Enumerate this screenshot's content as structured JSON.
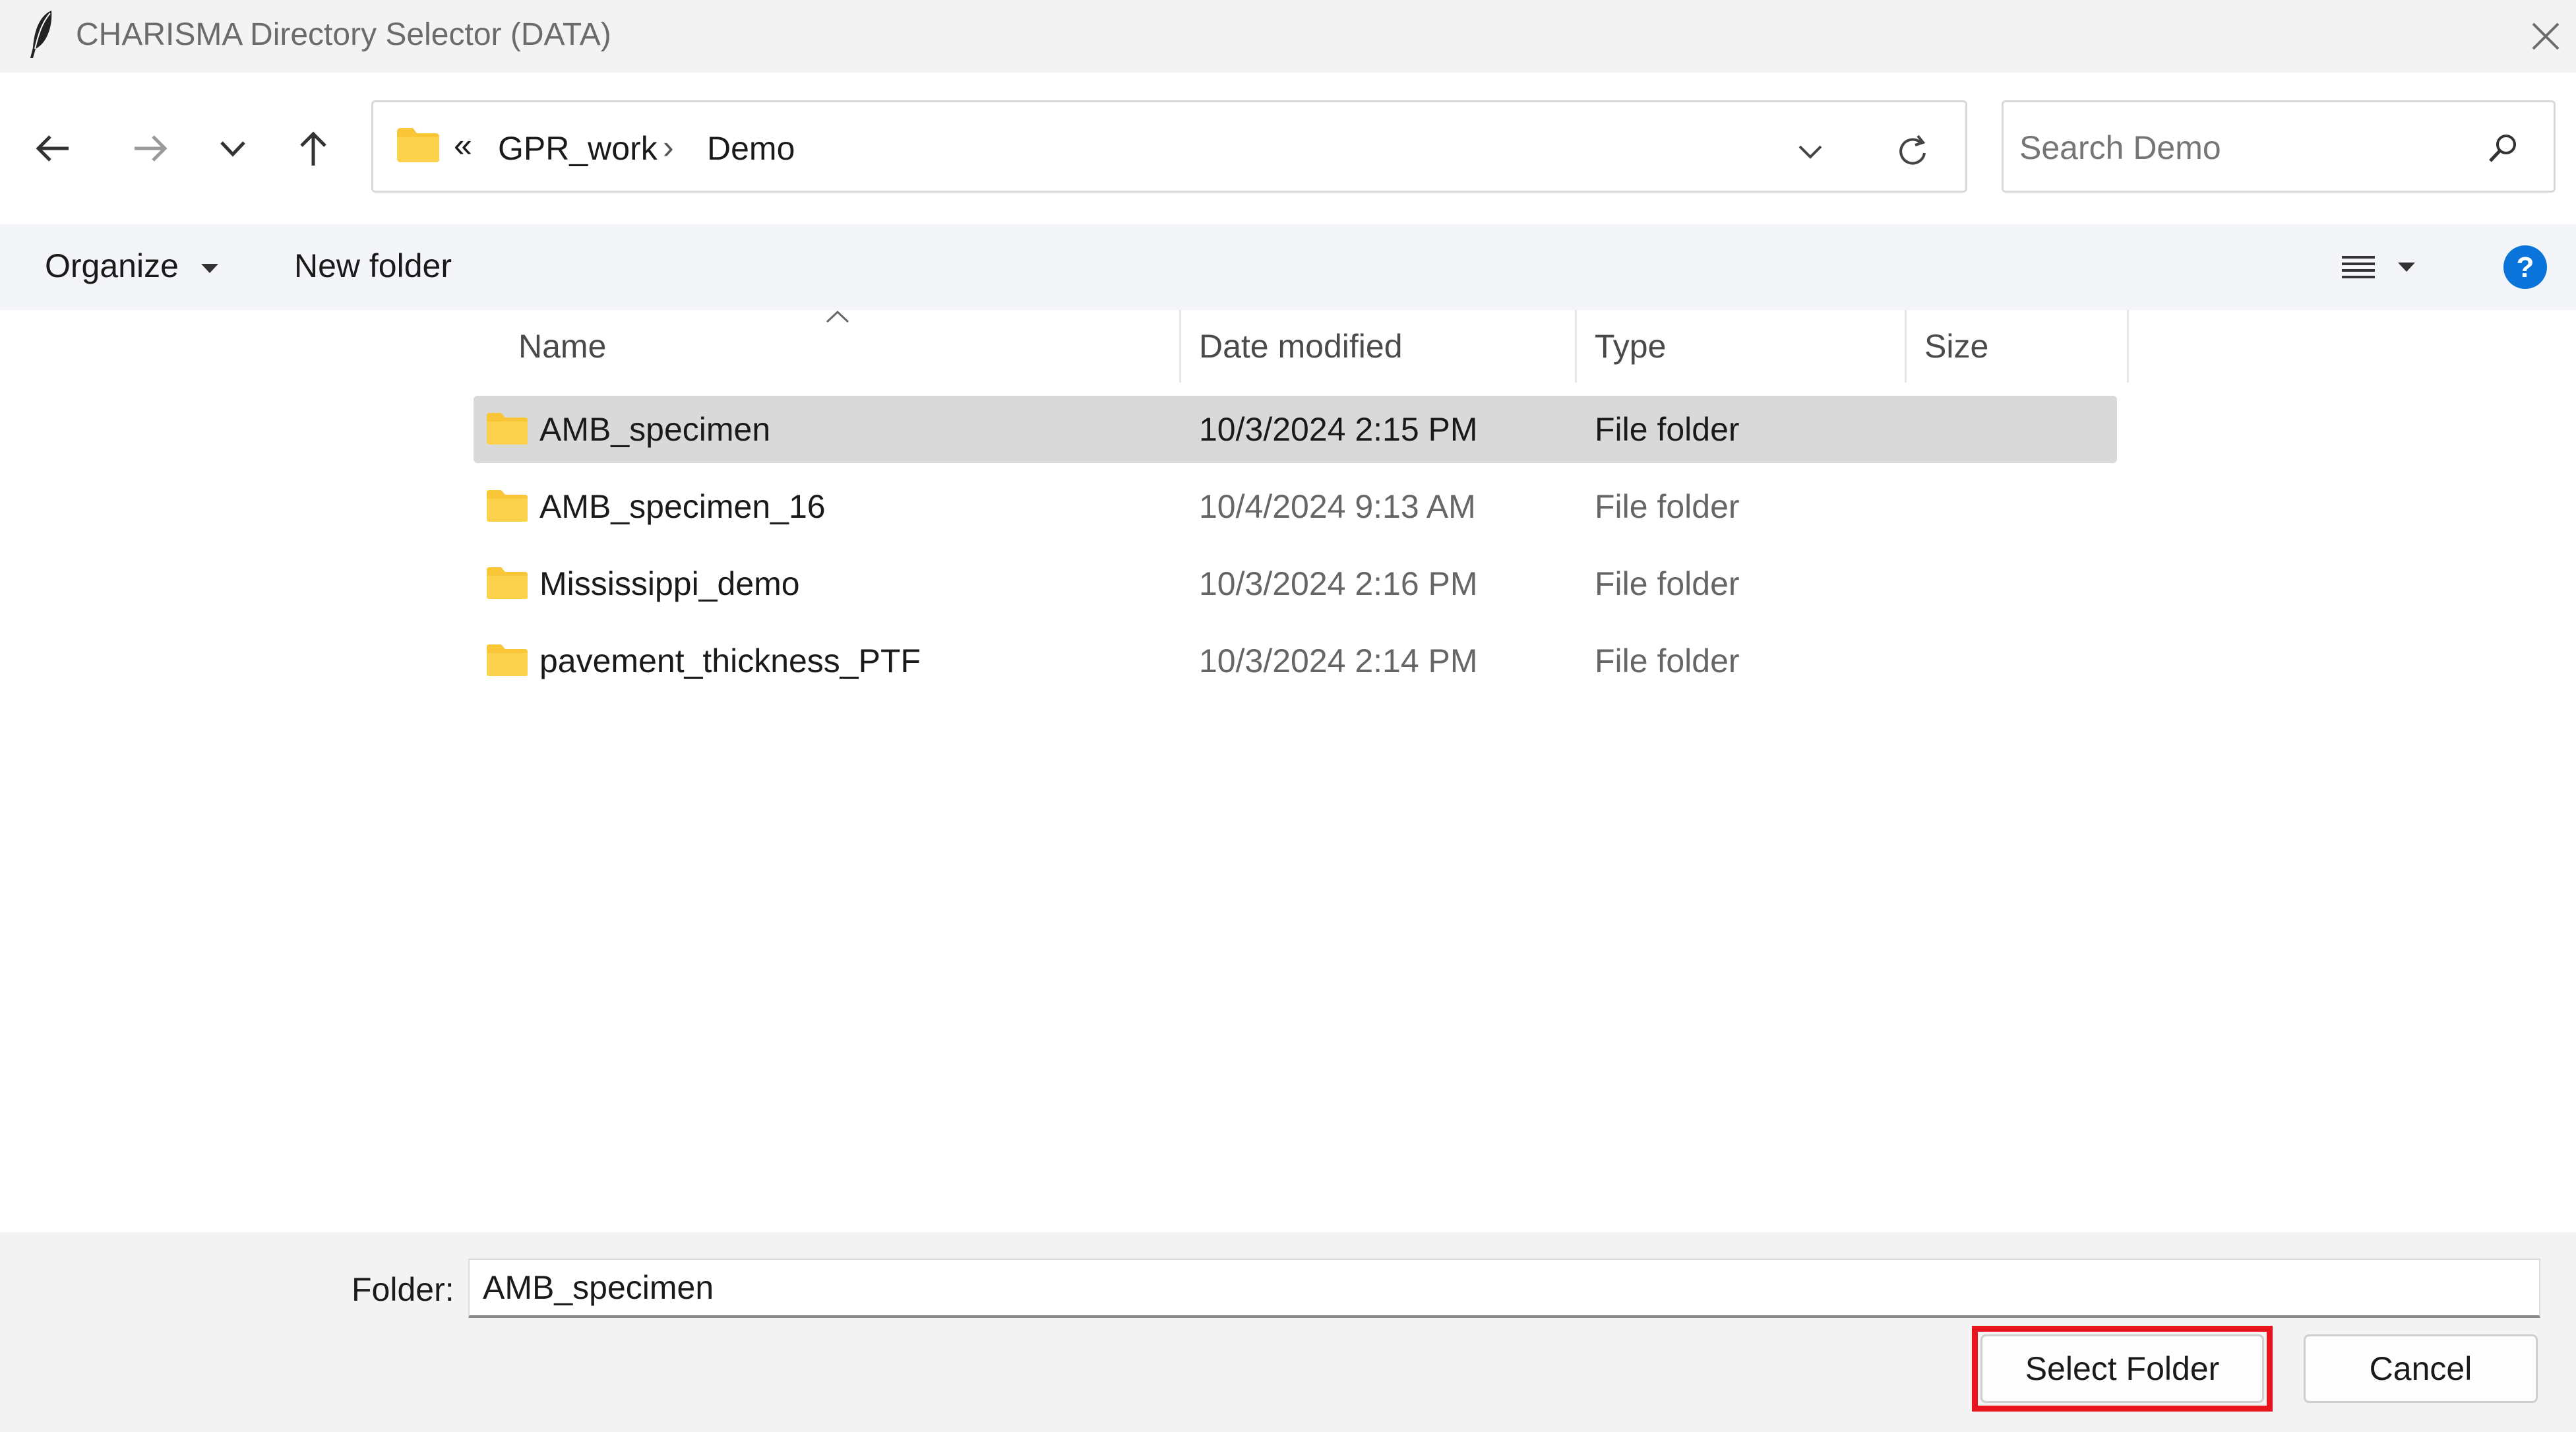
{
  "window": {
    "title": "CHARISMA Directory Selector (DATA)",
    "close_icon": "close-icon"
  },
  "nav": {
    "back_icon": "arrow-left-icon",
    "forward_icon": "arrow-right-icon",
    "recent_icon": "chevron-down-icon",
    "up_icon": "arrow-up-icon"
  },
  "address": {
    "overflow": "«",
    "crumbs": [
      "GPR_work",
      "Demo"
    ],
    "separator": "›"
  },
  "search": {
    "placeholder": "Search Demo"
  },
  "toolbar": {
    "organize_label": "Organize",
    "new_folder_label": "New folder"
  },
  "columns": {
    "name": "Name",
    "date": "Date modified",
    "type": "Type",
    "size": "Size"
  },
  "files": [
    {
      "name": "AMB_specimen",
      "date": "10/3/2024 2:15 PM",
      "type": "File folder",
      "size": "",
      "selected": true
    },
    {
      "name": "AMB_specimen_16",
      "date": "10/4/2024 9:13 AM",
      "type": "File folder",
      "size": "",
      "selected": false
    },
    {
      "name": "Mississippi_demo",
      "date": "10/3/2024 2:16 PM",
      "type": "File folder",
      "size": "",
      "selected": false
    },
    {
      "name": "pavement_thickness_PTF",
      "date": "10/3/2024 2:14 PM",
      "type": "File folder",
      "size": "",
      "selected": false
    }
  ],
  "footer": {
    "folder_label": "Folder:",
    "folder_value": "AMB_specimen",
    "select_label": "Select Folder",
    "cancel_label": "Cancel"
  },
  "colors": {
    "accent": "#0067c0",
    "highlight_box": "#e8141e",
    "folder": "#f8c636",
    "selected_row": "#d9d9d9"
  }
}
